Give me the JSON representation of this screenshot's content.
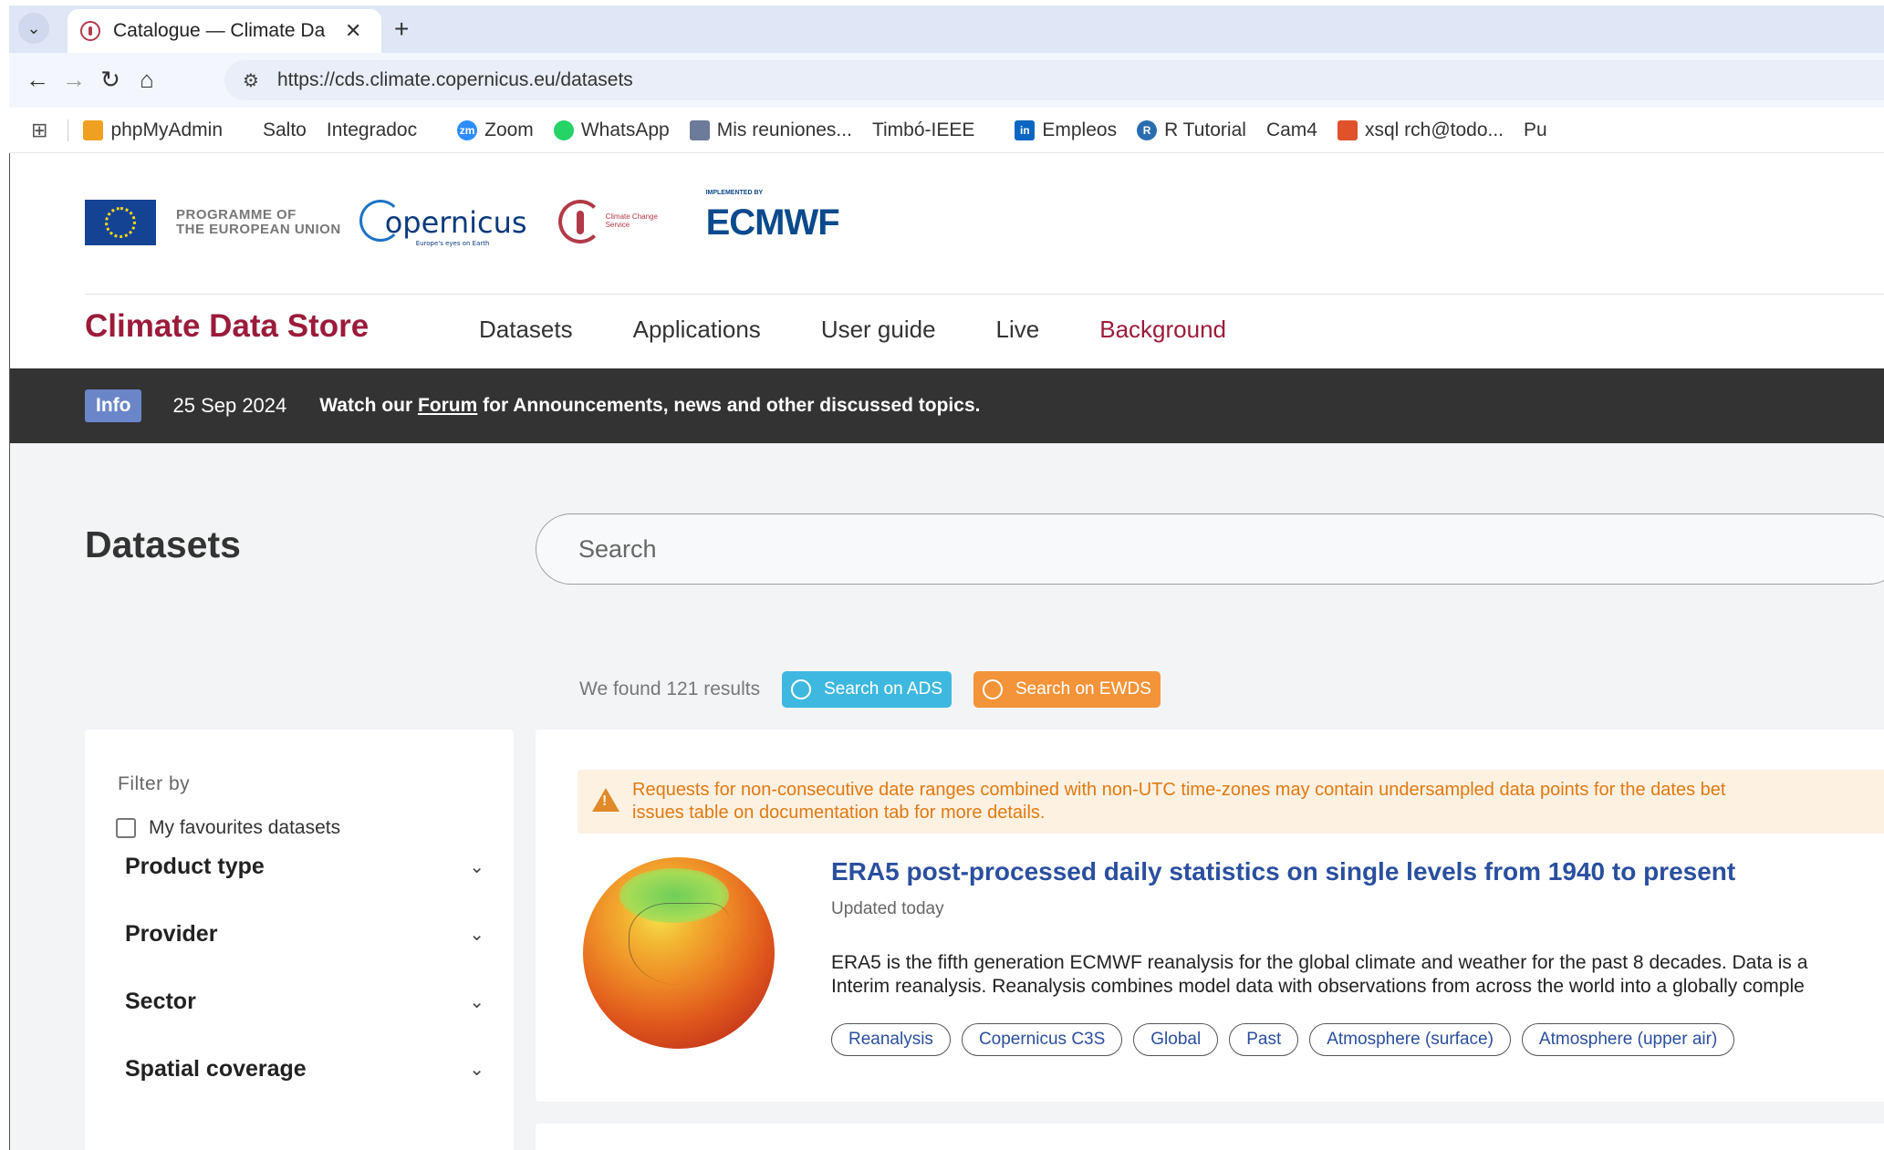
{
  "browser": {
    "tab_title": "Catalogue — Climate Da",
    "url": "https://cds.climate.copernicus.eu/datasets",
    "bookmarks": [
      {
        "label": "phpMyAdmin",
        "icon": "phpmyadmin-icon"
      },
      {
        "label": "",
        "icon": "globe-icon"
      },
      {
        "label": "Salto",
        "icon": "globe-icon"
      },
      {
        "label": "Integradoc",
        "icon": "globe-icon"
      },
      {
        "label": "",
        "icon": "globe-icon"
      },
      {
        "label": "Zoom",
        "icon": "zoom-icon"
      },
      {
        "label": "WhatsApp",
        "icon": "whatsapp-icon"
      },
      {
        "label": "Mis reuniones...",
        "icon": "meetings-icon"
      },
      {
        "label": "Timbó-IEEE",
        "icon": "globe-icon"
      },
      {
        "label": "",
        "icon": "globe-icon"
      },
      {
        "label": "Empleos",
        "icon": "linkedin-icon"
      },
      {
        "label": "R Tutorial",
        "icon": "r-icon"
      },
      {
        "label": "Cam4",
        "icon": "globe-icon"
      },
      {
        "label": "xsql rch@todo...",
        "icon": "xsql-icon"
      },
      {
        "label": "Pu",
        "icon": "globe-icon"
      }
    ]
  },
  "header": {
    "eu_text_line1": "PROGRAMME OF",
    "eu_text_line2": "THE EUROPEAN UNION",
    "copernicus_word": "opernicus",
    "copernicus_tagline": "Europe's eyes on Earth",
    "c3s_label": "Climate Change Service",
    "ecmwf_implemented": "IMPLEMENTED BY",
    "ecmwf_word": "ECMWF",
    "brand": "Climate Data Store",
    "nav": [
      "Datasets",
      "Applications",
      "User guide",
      "Live",
      "Background"
    ]
  },
  "infobar": {
    "badge": "Info",
    "date": "25 Sep 2024",
    "msg_before": "Watch our ",
    "msg_link": "Forum",
    "msg_after": " for Announcements, news and other discussed topics."
  },
  "main": {
    "title": "Datasets",
    "search_placeholder": "Search",
    "results_count": "We found 121 results",
    "btn_ads": "Search on ADS",
    "btn_ewds": "Search on EWDS"
  },
  "filter": {
    "title": "Filter by",
    "favourites": "My favourites datasets",
    "facets": [
      "Product type",
      "Provider",
      "Sector",
      "Spatial coverage"
    ]
  },
  "result": {
    "warning_line1": "Requests for non-consecutive date ranges combined with non-UTC time-zones may contain undersampled data points for the dates bet",
    "warning_line2": "issues table on documentation tab for more details.",
    "title": "ERA5 post-processed daily statistics on single levels from 1940 to present",
    "updated": "Updated today",
    "desc_line1": "ERA5 is the fifth generation ECMWF reanalysis for the global climate and weather for the past 8 decades. Data is a",
    "desc_line2": "Interim reanalysis. Reanalysis combines model data with observations from across the world into a globally comple",
    "tags": [
      "Reanalysis",
      "Copernicus C3S",
      "Global",
      "Past",
      "Atmosphere (surface)",
      "Atmosphere (upper air)"
    ]
  },
  "colors": {
    "brand": "#9b1b3a",
    "link": "#2a4f9e",
    "ads": "#3fb8df",
    "ewds": "#f3943a",
    "warning_text": "#e07a13"
  }
}
